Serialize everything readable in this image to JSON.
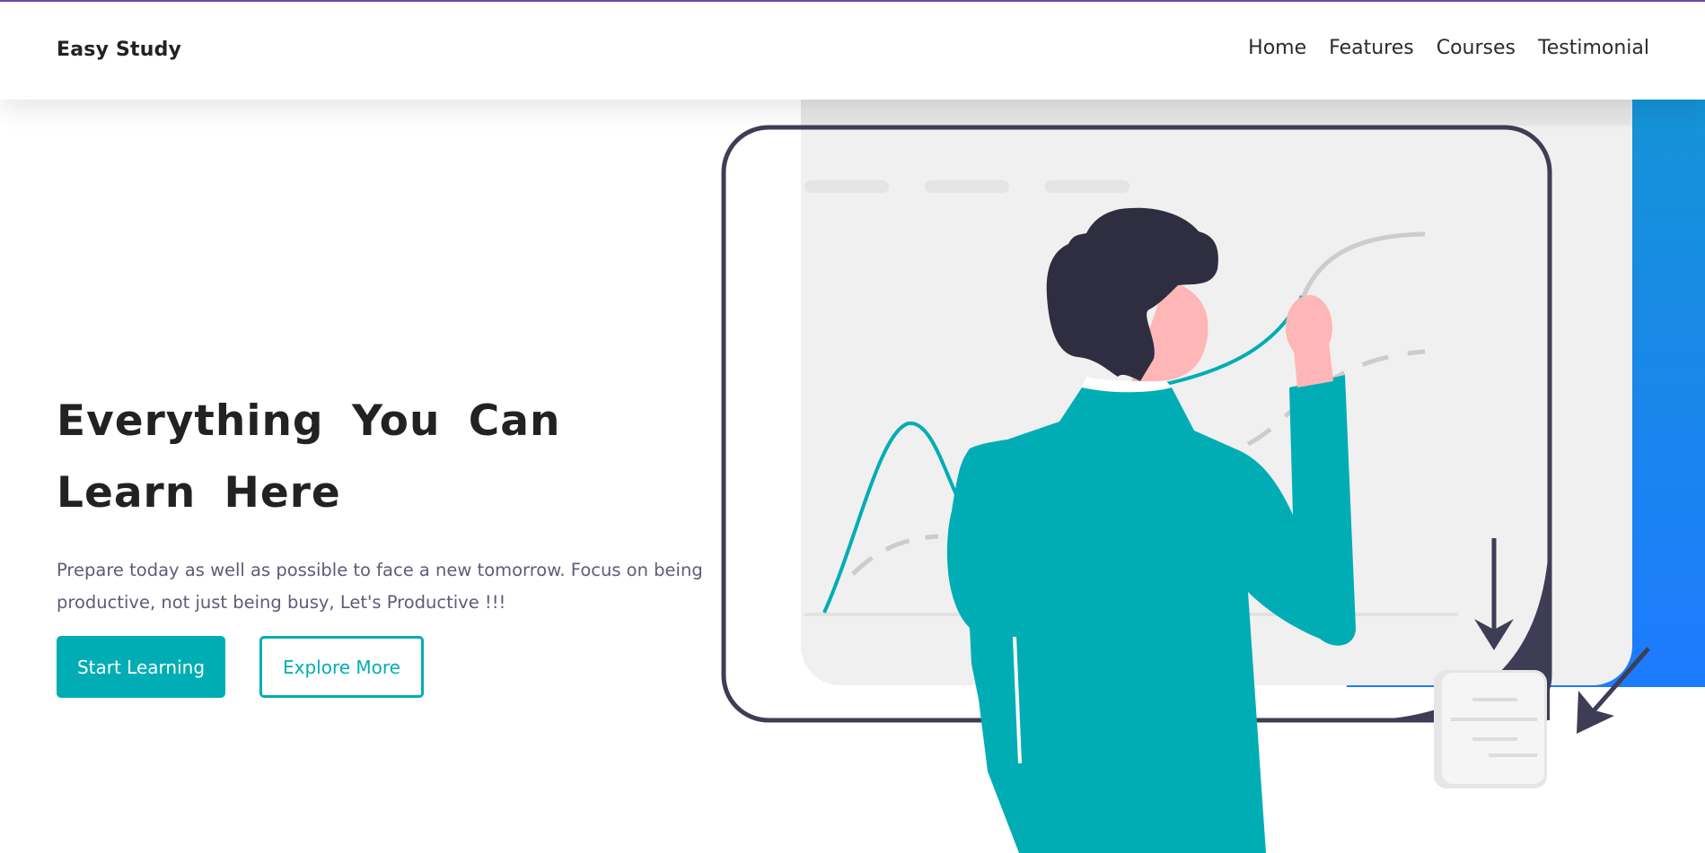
{
  "brand": {
    "name": "Easy Study"
  },
  "nav": {
    "items": [
      {
        "label": "Home"
      },
      {
        "label": "Features"
      },
      {
        "label": "Courses"
      },
      {
        "label": "Testimonial"
      }
    ]
  },
  "hero": {
    "title": "Everything You Can Learn Here",
    "description": "Prepare today as well as possible to face a new tomorrow. Focus on being productive, not just being busy, Let's Productive !!!",
    "primary_button": "Start Learning",
    "secondary_button": "Explore More"
  },
  "colors": {
    "accent_teal": "#00adb5",
    "dark_navy": "#3f3d56",
    "gradient_blue_top": "#1593d6",
    "gradient_blue_bottom": "#1d7bff",
    "skin": "#ffb6b6",
    "hair": "#2f2e41"
  }
}
